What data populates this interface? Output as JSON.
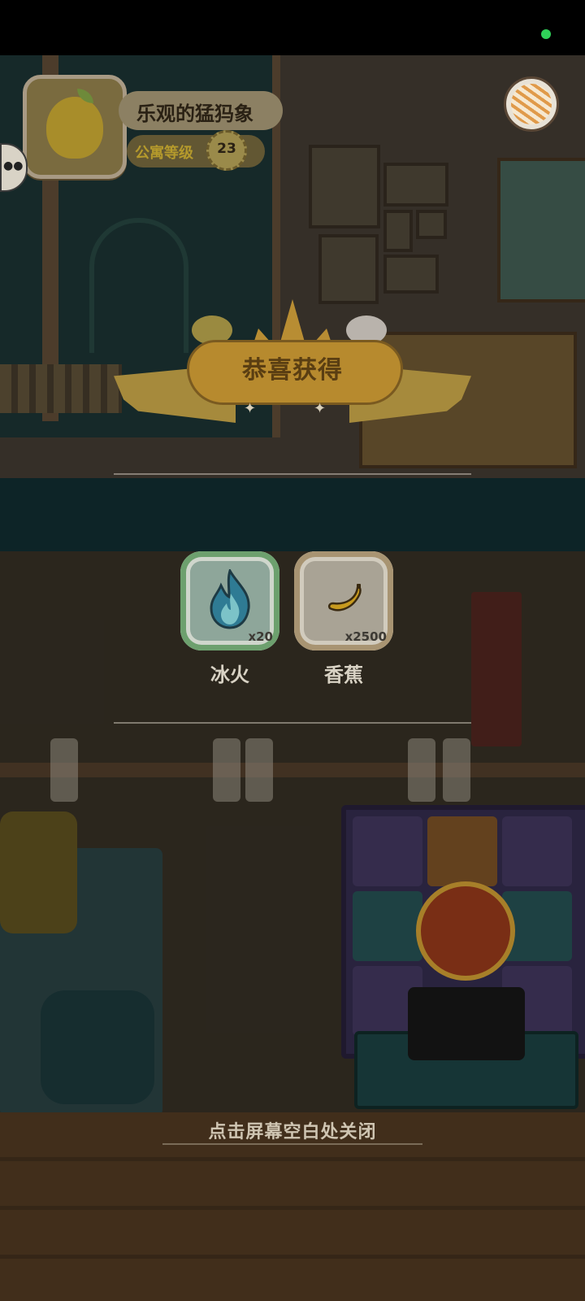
{
  "player": {
    "name": "乐观的猛犸象",
    "level_label": "公寓等级",
    "level": "23"
  },
  "popup": {
    "title": "恭喜获得",
    "rewards": [
      {
        "name": "冰火",
        "quantity": "x20",
        "icon": "blue-flame-icon"
      },
      {
        "name": "香蕉",
        "quantity": "x2500",
        "icon": "banana-icon"
      }
    ],
    "close_hint": "点击屏幕空白处关闭"
  },
  "top_right": {
    "icon": "yarn-ball-icon"
  },
  "status_bar": {
    "indicator_color": "#2fd158"
  }
}
